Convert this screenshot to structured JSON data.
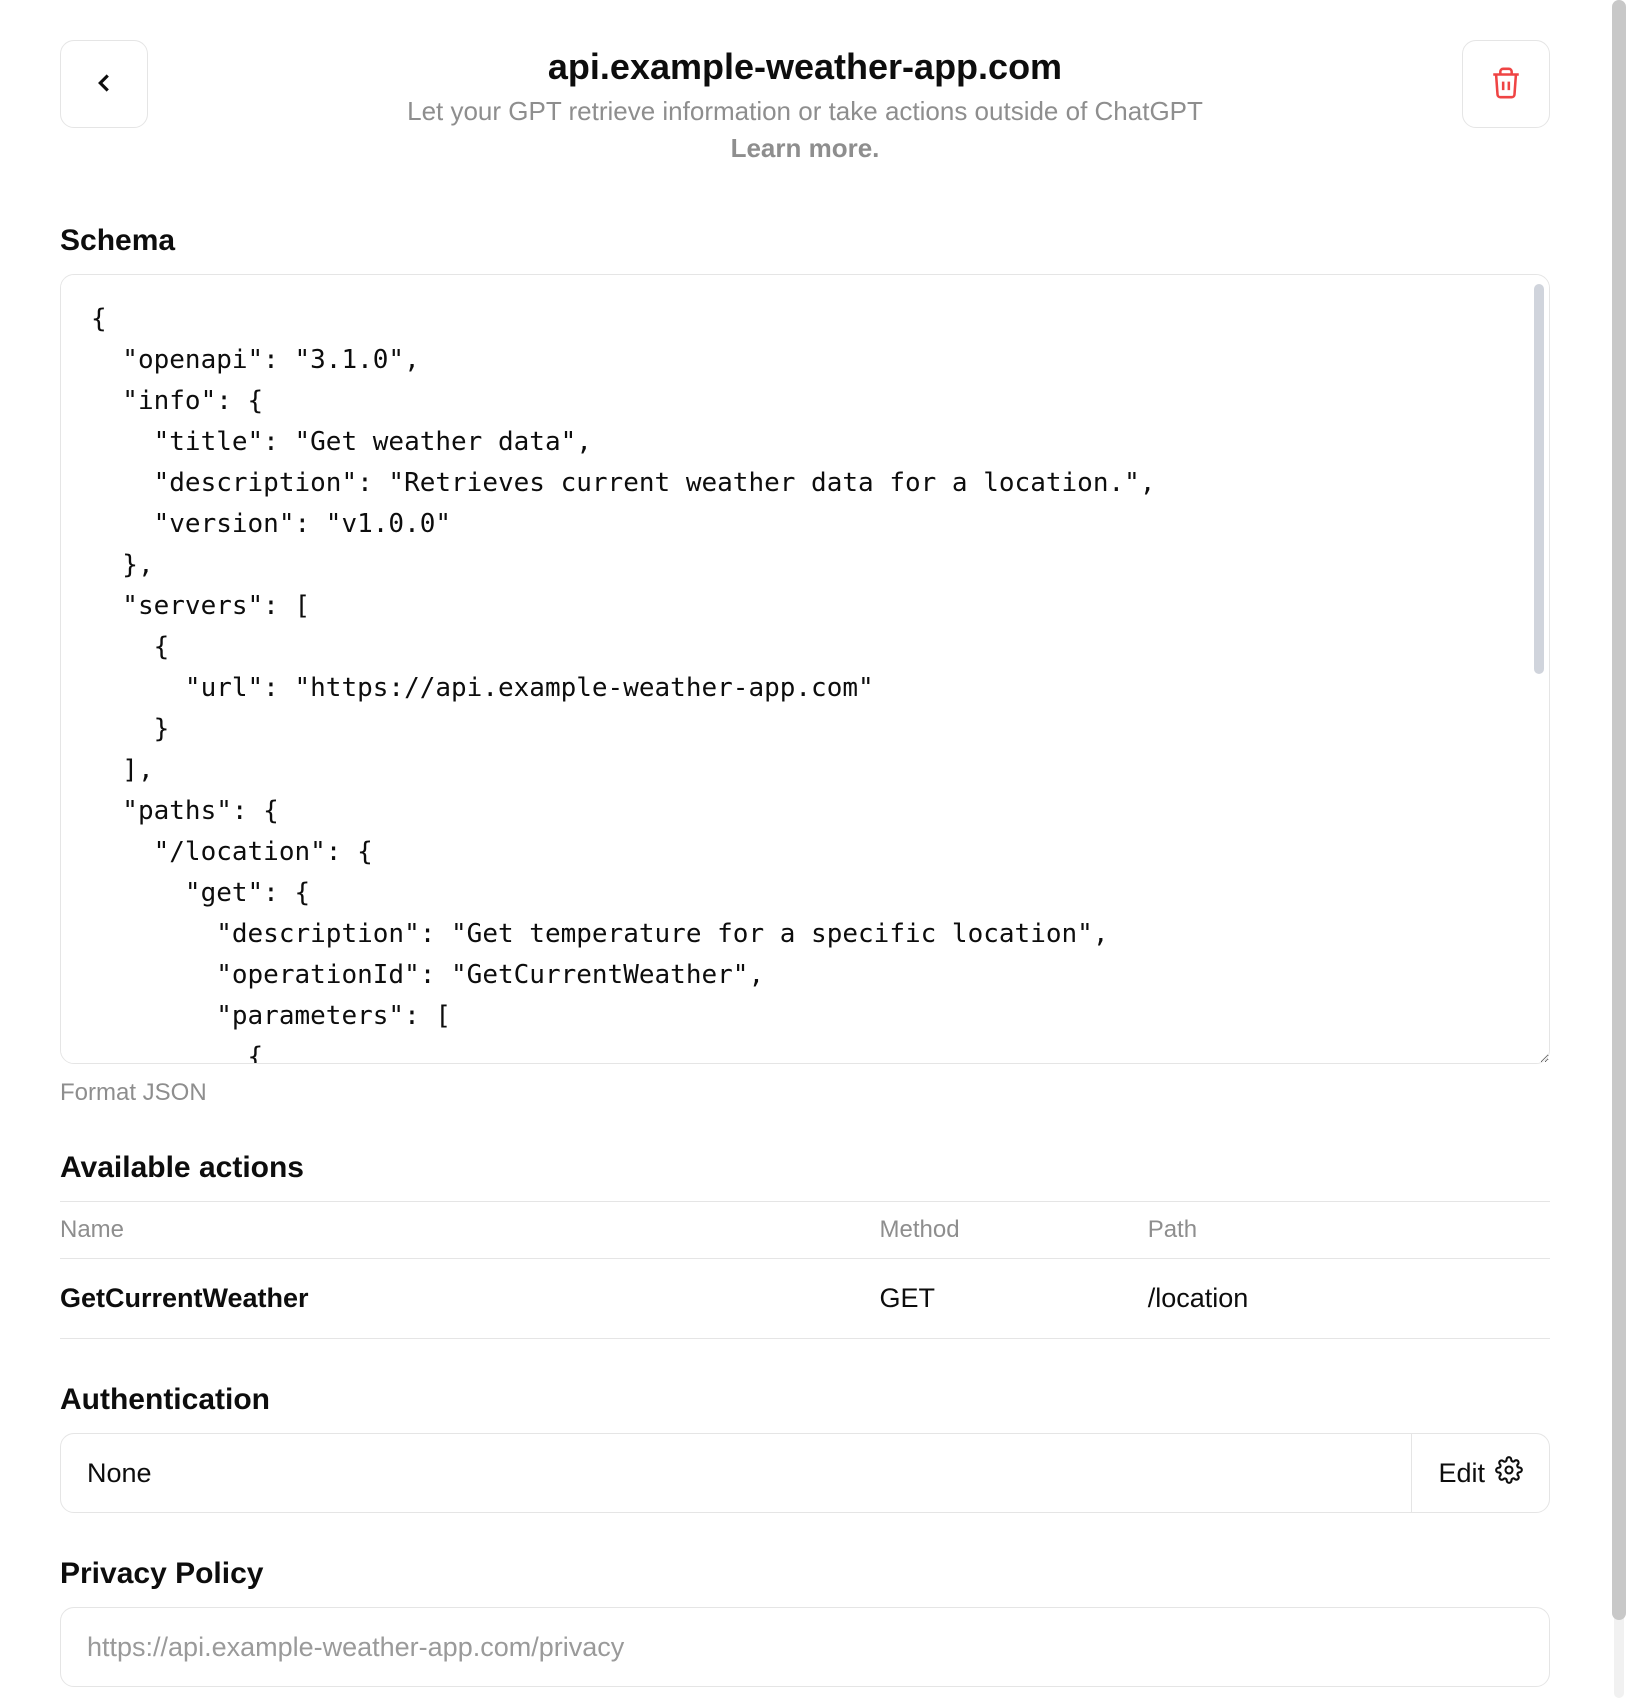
{
  "header": {
    "title": "api.example-weather-app.com",
    "subtitle": "Let your GPT retrieve information or take actions outside of ChatGPT",
    "learn_more": "Learn more."
  },
  "schema": {
    "label": "Schema",
    "value": "{\n  \"openapi\": \"3.1.0\",\n  \"info\": {\n    \"title\": \"Get weather data\",\n    \"description\": \"Retrieves current weather data for a location.\",\n    \"version\": \"v1.0.0\"\n  },\n  \"servers\": [\n    {\n      \"url\": \"https://api.example-weather-app.com\"\n    }\n  ],\n  \"paths\": {\n    \"/location\": {\n      \"get\": {\n        \"description\": \"Get temperature for a specific location\",\n        \"operationId\": \"GetCurrentWeather\",\n        \"parameters\": [\n          {",
    "format_label": "Format JSON"
  },
  "available_actions": {
    "label": "Available actions",
    "columns": {
      "name": "Name",
      "method": "Method",
      "path": "Path"
    },
    "rows": [
      {
        "name": "GetCurrentWeather",
        "method": "GET",
        "path": "/location"
      }
    ]
  },
  "authentication": {
    "label": "Authentication",
    "value": "None",
    "edit_label": "Edit"
  },
  "privacy": {
    "label": "Privacy Policy",
    "placeholder": "https://api.example-weather-app.com/privacy"
  }
}
